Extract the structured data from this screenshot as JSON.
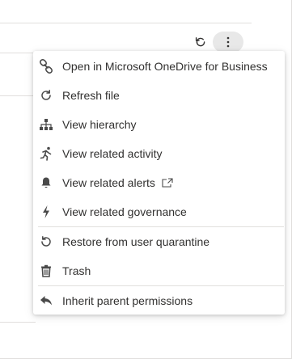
{
  "toolbar": {
    "refresh_icon": "refresh-icon",
    "more_icon": "more-vertical-icon"
  },
  "menu": {
    "items": [
      {
        "label": "Open in Microsoft OneDrive for Business",
        "icon": "link-icon"
      },
      {
        "label": "Refresh file",
        "icon": "refresh-icon"
      },
      {
        "label": "View hierarchy",
        "icon": "hierarchy-icon"
      },
      {
        "label": "View related activity",
        "icon": "running-icon"
      },
      {
        "label": "View related alerts",
        "icon": "bell-icon",
        "trailing_icon": "open-in-new-window-icon"
      },
      {
        "label": "View related governance",
        "icon": "lightning-icon"
      },
      {
        "label": "Restore from user quarantine",
        "icon": "restore-icon"
      },
      {
        "label": "Trash",
        "icon": "trash-icon"
      },
      {
        "label": "Inherit parent permissions",
        "icon": "reply-icon"
      }
    ]
  },
  "colors": {
    "text": "#323130",
    "icon": "#4a4a4a",
    "separator": "#e1dfdd",
    "more_button_bg": "#e8e8e8"
  }
}
